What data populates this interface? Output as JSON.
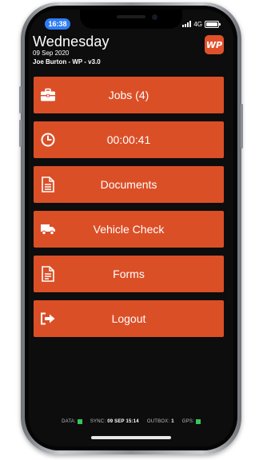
{
  "status_bar": {
    "time": "16:38",
    "network": "4G"
  },
  "header": {
    "day": "Wednesday",
    "date": "09 Sep 2020",
    "user": "Joe Burton - WP - v3.0",
    "logo_text": "WP",
    "logo_icon": "wp-logo-icon"
  },
  "menu": {
    "items": [
      {
        "label": "Jobs (4)",
        "icon": "briefcase-icon"
      },
      {
        "label": "00:00:41",
        "icon": "clock-icon"
      },
      {
        "label": "Documents",
        "icon": "document-icon"
      },
      {
        "label": "Vehicle Check",
        "icon": "truck-icon"
      },
      {
        "label": "Forms",
        "icon": "form-icon"
      },
      {
        "label": "Logout",
        "icon": "logout-arrow-icon"
      }
    ]
  },
  "footer": {
    "data_label": "DATA:",
    "sync_label": "SYNC:",
    "sync_value": "09 SEP 15:14",
    "outbox_label": "OUTBOX:",
    "outbox_value": "1",
    "gps_label": "GPS:"
  },
  "colors": {
    "button": "#db4f27",
    "background": "#0d0d0d",
    "ok_indicator": "#35c75a",
    "time_pill": "#2f7df6"
  }
}
